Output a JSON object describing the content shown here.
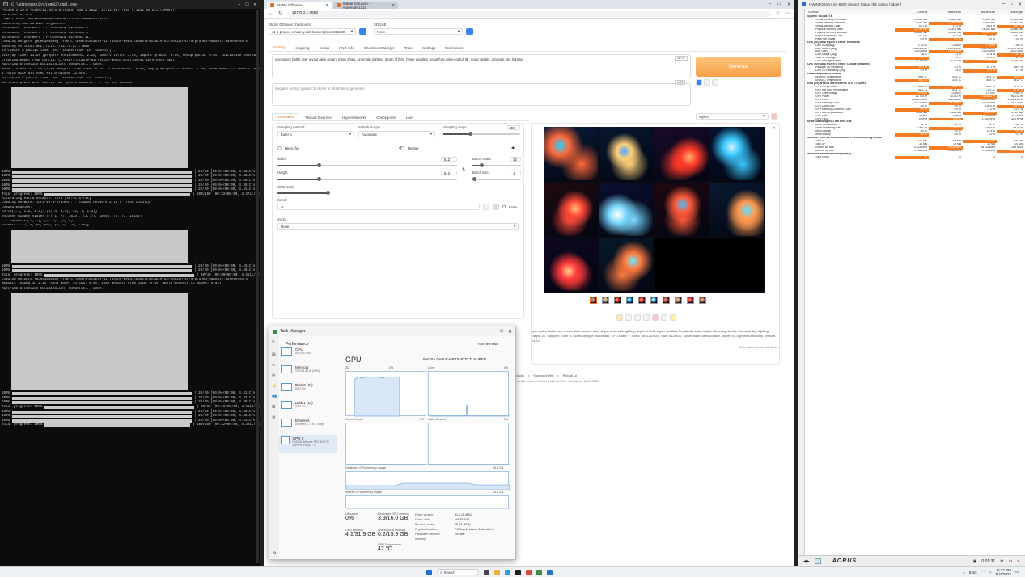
{
  "console": {
    "title": "C:\\Windows\\System32\\cmd.exe",
    "lines_top": [
      "Python 3.10.6 (tags/v3.10.6:9c7b4bd, Aug  1 2022, 21:53:49) [MSC v.1932 64 bit (AMD64)]",
      "Version: v1.6.0",
      "Commit hash: 5ef669de080814067961f28357256e8fe27544f4",
      "Launching Web UI with arguments:",
      "no module 'xformers'. Processing without...",
      "no module 'xformers'. Processing without...",
      "No module 'xformers'. Proceeding without it.",
      "Loading weights [6ce0161689] from C:\\Users\\stable-diffusion-webui\\models\\Stable-diffusion\\v1-5-pruned-emaonly.safetensors",
      "Running on local URL:  http://127.0.0.1:7860",
      "",
      "To create a public link, set `share=True` in `launch()`.",
      "Startup time: 11.2s (prepare environment: 2.1s, import torch: 3.4s, import gradio: 0.9s, setup paths: 0.6s, initialize shared: 0.2s).",
      "Creating model from config: C:\\Users\\stable-diffusion-webui\\configs\\v1-inference.yaml",
      "Applying attention optimization: Doggettx... done.",
      "Model loaded in 3.6s (load weights from disk: 0.7s, create model: 0.4s, apply weights to model: 1.9s, move model to device: 0.3s).",
      "1 torch HCCF all seed set produced 12 hrs.",
      "To create a public link, set `share=True` in `launch()`.",
      "Ui hooks print when safely ran 'press control + c' on the window."
    ],
    "progress_lines": [
      {
        "label": "100%",
        "tail": "| 20/20 [00:04<00:00,  4.41it/s]"
      },
      {
        "label": "100%",
        "tail": "| 20/20 [00:04<00:00,  4.42it/s]"
      },
      {
        "label": "100%",
        "tail": "| 20/20 [00:04<00:00,  4.40it/s]"
      },
      {
        "label": "100%",
        "tail": "| 20/20 [00:04<00:00,  4.39it/s]"
      },
      {
        "label": "100%",
        "tail": "| 20/20 [00:04<00:00,  4.41it/s]"
      },
      {
        "label": "Total progress: 100%",
        "tail": "| 100/100 [00:22<00:00,  4.37it/s]"
      }
    ],
    "lines_mid": [
      "Activating extra network: lora [sd-v1.5-fix]",
      "Loading network: lora-v1-5-pruned ... loaded network 2 to 9 'from Locally'",
      "Loaded modules:",
      "    torch(1.1, 1.2, 1.3), (3, 4, 8.0), (2, 7, 1.1)]",
      "    encoder_hidden_states = [(1, 77, 1024), (2, 77, 1024), (2, 77, 1024)]",
      "    t = tensor(<( 1, 1), (3, 4), (4, 8)]",
      "    latents = (1, 4, 64, 64), (2, 4, 128, 128)]"
    ],
    "progress_lines_2": [
      {
        "label": "100%",
        "tail": "| 20/20 [00:04<00:00,  4.43it/s]"
      },
      {
        "label": "100%",
        "tail": "| 20/20 [00:04<00:00,  4.40it/s]"
      },
      {
        "label": "Total progress: 100%",
        "tail": "| 40/40 [00:09<00:00,  4.38it/s]"
      }
    ],
    "lines_low": [
      "Loading weights [6ce0161689] from C:\\Users\\stable-diffusion-webui\\models\\Stable-diffusion\\v1-5-pruned-emaonly.safetensors",
      "Weights loaded in 2.1s (send model to cpu: 0.5s, load weights from disk: 0.8s, apply weights to model: 0.8s).",
      "Applying attention optimization: Doggettx... done."
    ],
    "progress_lines_3": [
      {
        "label": "100%",
        "tail": "| 20/20 [00:04<00:00,  4.41it/s]"
      },
      {
        "label": "100%",
        "tail": "| 20/20 [00:04<00:00,  4.43it/s]"
      },
      {
        "label": "100%",
        "tail": "| 20/20 [00:04<00:00,  4.39it/s]"
      },
      {
        "label": "Total progress: 100%",
        "tail": "| 60/60 [00:13<00:00,  4.40it/s]"
      },
      {
        "label": "100%",
        "tail": "| 20/20 [00:04<00:00,  4.42it/s]"
      },
      {
        "label": "100%",
        "tail": "| 20/20 [00:04<00:00,  4.40it/s]"
      },
      {
        "label": "100%",
        "tail": "| 20/20 [00:04<00:00,  4.41it/s]"
      },
      {
        "label": "Total progress: 100%",
        "tail": "| 100/100 [00:22<00:00,  4.39it/s]"
      }
    ]
  },
  "browser": {
    "tabs": [
      {
        "label": "Stable Diffusion"
      },
      {
        "label": "Stable Diffusion - Automatic1111"
      }
    ],
    "url": "127.0.0.1:7860",
    "checkpoint_label": "Stable Diffusion checkpoint",
    "checkpoint_value": "v1-5-pruned-emaonly.safetensors [6ce0161689]",
    "vae_label": "SD VAE",
    "vae_value": "None",
    "top_tabs": [
      "txt2img",
      "img2img",
      "Extras",
      "PNG Info",
      "Checkpoint Merger",
      "Train",
      "Settings",
      "Extensions"
    ],
    "prompt": "epic space battle over a vast alien ocean, many ships, cinematic lighting, depth of field, hyper detailed, beautifully color-coded, 8k, many details, dramatic sky, lighting",
    "prompt_count": "38/75",
    "neg_placeholder": "Negative prompt (press Ctrl+Enter or Alt+Enter to generate)",
    "neg_count": "0/75",
    "generate_label": "Generate",
    "styles_label": "Styles",
    "sub_tabs": [
      "Generation",
      "Textual Inversion",
      "Hypernetworks",
      "Checkpoints",
      "Lora"
    ],
    "sampling_method_label": "Sampling method",
    "sampling_method_value": "Euler a",
    "schedule_type_label": "Schedule type",
    "schedule_type_value": "Automatic",
    "sampling_steps_label": "Sampling steps",
    "sampling_steps_value": "20",
    "hires_fix": "Hires. fix",
    "refiner": "Refiner",
    "width_label": "Width",
    "width_value": "512",
    "height_label": "Height",
    "height_value": "512",
    "batch_count_label": "Batch count",
    "batch_count_value": "16",
    "batch_size_label": "Batch size",
    "batch_size_value": "1",
    "cfg_label": "CFG Scale",
    "cfg_value": "7",
    "seed_label": "Seed",
    "seed_value": "-1",
    "extra_label": "Extra",
    "script_label": "Script",
    "script_value": "None",
    "info_text": "epic space battle over a vast alien ocean, many ships, cinematic lighting, depth of field, hyper detailed, beautifully color-coded, 8k, many details, dramatic sky, lighting",
    "info_params": "Steps: 20, Sampler: Euler a, Schedule type: Automatic, CFG scale: 7, Seed: 3641207445, Size: 512x512, Model hash: 6ce0161689, Model: v1-5-pruned-emaonly, Version: v1.6.0",
    "info_time": "Time taken: 1 min. 12.4 sec.",
    "footer_links": [
      "API",
      "Github",
      "Gradio",
      "Startup profile",
      "Reload UI"
    ],
    "footer_versions": "version: v1.6.0  •  python: 3.10.6  •  torch: 2.0.1+cu118  •  xformers: N/A  •  gradio: 3.41.2  •  checkpoint: 6ce0161689"
  },
  "taskmgr": {
    "title": "Task Manager",
    "section": "Performance",
    "run_task": "Run new task",
    "items": [
      {
        "name": "CPU",
        "sub": "5% 4.20 GHz"
      },
      {
        "name": "Memory",
        "sub": "15.7/31.8 GB (49%)"
      },
      {
        "name": "Disk 0 (C:)",
        "sub": "SSD 0%"
      },
      {
        "name": "Disk 1 (D:)",
        "sub": "SSD 0%"
      },
      {
        "name": "Ethernet",
        "sub": "Ethernet S: 0 R: 0 Kbps"
      },
      {
        "name": "GPU 0",
        "sub": "NVIDIA GeForce RTX 4070 Ti SUPER 0% (42 °C)"
      }
    ],
    "gpu_title": "GPU",
    "gpu_name": "NVIDIA GeForce RTX 4070 Ti SUPER",
    "graph1_label": "3D",
    "graph1_pct": "0%",
    "graph2_label": "Copy",
    "graph2_pct": "0%",
    "graph3_label": "Video Encode",
    "graph3_pct": "0%",
    "graph4_label": "Video Decode",
    "graph4_pct": "0%",
    "mem_label": "Dedicated GPU memory usage",
    "mem_max": "16.0 GB",
    "shared_label": "Shared GPU memory usage",
    "shared_max": "15.9 GB",
    "util_label": "Utilization",
    "util_value": "0%",
    "ded_label": "Dedicated GPU memory",
    "ded_value": "3.9/16.0 GB",
    "gpumem_label": "GPU Memory",
    "gpumem_value": "4.1/31.9 GB",
    "shared_mem_label": "Shared GPU memory",
    "shared_mem_value": "0.2/15.9 GB",
    "temp_label": "GPU Temperature",
    "temp_value": "42 °C",
    "driver_version_label": "Driver version:",
    "driver_version": "31.0.15.4601",
    "driver_date_label": "Driver date:",
    "driver_date": "10/26/2023",
    "directx_label": "DirectX version:",
    "directx": "12 (FL 12.1)",
    "location_label": "Physical location:",
    "location": "PCI bus 1, device 0, function 0",
    "hwres_label": "Hardware reserved memory:",
    "hwres": "207 MB"
  },
  "hwinfo": {
    "title": "HWiNFO64 v7.64-5300 Sensor Status [64 values hidden]",
    "columns": [
      "Sensor",
      "Current",
      "Minimum",
      "Maximum",
      "Average"
    ],
    "sections": [
      {
        "title": "System: GIGABYTE",
        "rows": [
          [
            "Virtual Memory Committed",
            "22,811 MB",
            "21,840 MB",
            "23,460 MB",
            "22,653 MB"
          ],
          [
            "Virtual Memory Available",
            "23,624 MB",
            "22,974 MB",
            "24,594 MB",
            "23,782 MB"
          ],
          [
            "Virtual Memory Load",
            "49.1 %",
            "47.0 %",
            "50.5 %",
            "48.7 %"
          ],
          [
            "Physical Memory Used",
            "15,745 MB",
            "15,101 MB",
            "16,302 MB",
            "15,688 MB"
          ],
          [
            "Physical Memory Available",
            "16,824 MB",
            "16,266 MB",
            "17,467 MB",
            "16,881 MB"
          ],
          [
            "Physical Memory Load",
            "48.3 %",
            "46.3 %",
            "50.0 %",
            "48.2 %"
          ],
          [
            "Page File Usage",
            "0.0 %",
            "0.0 %",
            "0.0 %",
            "0.0 %"
          ]
        ]
      },
      {
        "title": "CPU [#0]: AMD Ryzen 9 7950X: Enhanced",
        "rows": [
          [
            "Core VIDs (avg)",
            "1.121 V",
            "0.986 V",
            "1.304 V",
            "1.102 V"
          ],
          [
            "Core Clocks (avg)",
            "4,325.6 MHz",
            "3,214.5 MHz",
            "5,472.0 MHz",
            "4,280.3 MHz"
          ],
          [
            "Bus Clock",
            "100.0 MHz",
            "100.0 MHz",
            "100.0 MHz",
            "100.0 MHz"
          ],
          [
            "Core Usage (avg)",
            "4.8 %",
            "1.2 %",
            "24.6 %",
            "6.1 %"
          ],
          [
            "Total CPU Usage",
            "5.2 %",
            "1.4 %",
            "25.1 %",
            "6.4 %"
          ],
          [
            "CPU Package Power",
            "47.315 W",
            "38.102 W",
            "121.446 W",
            "52.804 W"
          ]
        ]
      },
      {
        "title": "CPU [#0]: AMD Ryzen 9 7950X: C-State Residency",
        "rows": [
          [
            "Package C6 Residency",
            "62.4 %",
            "8.1 %",
            "81.2 %",
            "58.9 %"
          ],
          [
            "Core C0 Residency (avg)",
            "6.3 %",
            "1.6 %",
            "31.4 %",
            "7.9 %"
          ]
        ]
      },
      {
        "title": "DIMM Temperature Sensor",
        "rows": [
          [
            "DIMM[0] Temperature",
            "38.5 °C",
            "37.8 °C",
            "39.3 °C",
            "38.4 °C"
          ],
          [
            "DIMM[1] Temperature",
            "38.0 °C",
            "37.5 °C",
            "38.8 °C",
            "38.1 °C"
          ]
        ]
      },
      {
        "title": "GPU [#0]: NVIDIA GeForce RTX 4070 Ti SUPER",
        "rows": [
          [
            "GPU Temperature",
            "42.0 °C",
            "38.0 °C",
            "64.0 °C",
            "47.3 °C"
          ],
          [
            "GPU Hot Spot Temperature",
            "51.2 °C",
            "47.1 °C",
            "77.5 °C",
            "57.8 °C"
          ],
          [
            "GPU Core Voltage",
            "0.910 V",
            "0.880 V",
            "1.070 V",
            "0.962 V"
          ],
          [
            "GPU Power",
            "21.704 W",
            "18.411 W",
            "284.613 W",
            "96.212 W"
          ],
          [
            "GPU Clock",
            "2,610.0 MHz",
            "210.0 MHz",
            "2,805.0 MHz",
            "1,924.3 MHz"
          ],
          [
            "GPU Memory Clock",
            "1,312.5 MHz",
            "101.3 MHz",
            "1,312.5 MHz",
            "1,104.2 MHz"
          ],
          [
            "GPU Core Load",
            "0.0 %",
            "0.0 %",
            "100.0 %",
            "31.4 %"
          ],
          [
            "GPU Memory Controller Load",
            "0.0 %",
            "0.0 %",
            "77.0 %",
            "21.6 %"
          ],
          [
            "GPU Memory Allocated",
            "3,981 MB",
            "1,124 MB",
            "8,962 MB",
            "4,210 MB"
          ],
          [
            "GPU Fan1",
            "0 RPM",
            "0 RPM",
            "1,148 RPM",
            "402 RPM"
          ],
          [
            "GPU Fan2",
            "0 RPM",
            "0 RPM",
            "1,152 RPM",
            "404 RPM"
          ]
        ]
      },
      {
        "title": "Drive: Samsung SSD 990 PRO 2TB",
        "rows": [
          [
            "Drive Temperature",
            "41 °C",
            "40 °C",
            "43 °C",
            "41 °C"
          ],
          [
            "Drive Remaining Life",
            "100.0 %",
            "100.0 %",
            "100.0 %",
            "100.0 %"
          ],
          [
            "Read Activity",
            "0.0 %",
            "0.0 %",
            "12.4 %",
            "0.6 %"
          ],
          [
            "Write Activity",
            "0.0 %",
            "0.0 %",
            "3.1 %",
            "0.2 %"
          ]
        ]
      },
      {
        "title": "Network: RealTek Semiconductor RTL8125 Gaming 2.5GbE",
        "rows": [
          [
            "Total DL",
            "312 MB",
            "298 MB",
            "312 MB",
            "305 MB"
          ],
          [
            "Total UP",
            "21 MB",
            "19 MB",
            "21 MB",
            "20 MB"
          ],
          [
            "Current DL rate",
            "0.421 KB/s",
            "0.000 KB/s",
            "18.112 KB/s",
            "1.204 KB/s"
          ],
          [
            "Current UP rate",
            "0.118 KB/s",
            "0.000 KB/s",
            "4.921 KB/s",
            "0.341 KB/s"
          ]
        ]
      },
      {
        "title": "Windows Hardware Errors (WHEA)",
        "rows": [
          [
            "Total Errors",
            "0",
            "0",
            "0",
            "0"
          ]
        ]
      }
    ],
    "bottom_time": "0:01:31",
    "brand": "AORUS"
  },
  "taskbar": {
    "search": "Search",
    "time": "6:12 PM",
    "date": "11/2/2023",
    "lang": "ENG"
  },
  "colors": {
    "accent_orange": "#f47b20",
    "generate_orange": "#f6a04a",
    "console_bg": "#0c0c0c",
    "graph_blue": "#5b9bd5"
  }
}
